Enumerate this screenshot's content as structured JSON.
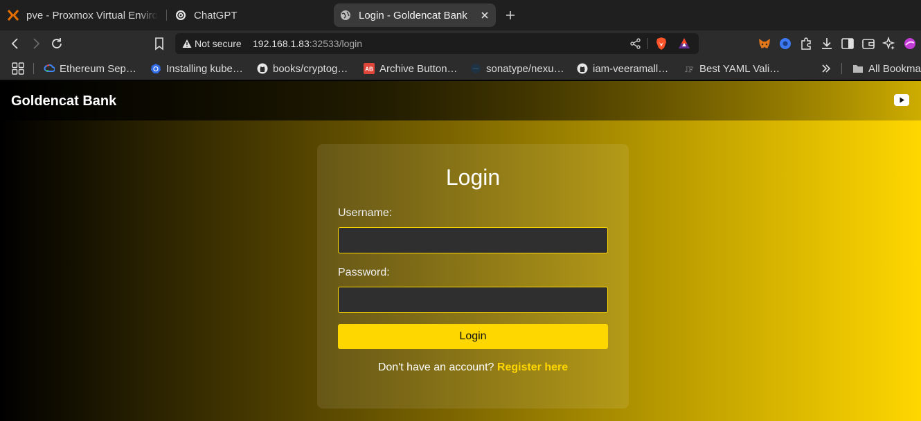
{
  "browser": {
    "tabs": [
      {
        "label": "pve - Proxmox Virtual Environment",
        "icon": "proxmox-icon"
      },
      {
        "label": "ChatGPT",
        "icon": "chatgpt-icon"
      },
      {
        "label": "Login - Goldencat Bank",
        "icon": "globe-icon",
        "active": true
      }
    ],
    "address": {
      "security_label": "Not secure",
      "host": "192.168.1.83",
      "path": ":32533/login"
    },
    "bookmarks": [
      {
        "label": "Ethereum Sep…",
        "icon": "google-cloud-icon"
      },
      {
        "label": "Installing kube…",
        "icon": "kubernetes-icon"
      },
      {
        "label": "books/cryptog…",
        "icon": "github-icon"
      },
      {
        "label": "Archive Button…",
        "icon": "ab-icon"
      },
      {
        "label": "sonatype/nexu…",
        "icon": "sonatype-icon"
      },
      {
        "label": "iam-veeramall…",
        "icon": "github-icon"
      },
      {
        "label": "Best YAML Vali…",
        "icon": "jf-icon"
      },
      {
        "label": "All Bookmarks",
        "icon": "folder-icon"
      }
    ]
  },
  "site": {
    "brand": "Goldencat Bank",
    "login": {
      "title": "Login",
      "username_label": "Username:",
      "username_value": "",
      "password_label": "Password:",
      "password_value": "",
      "submit_label": "Login",
      "register_prompt": "Don't have an account?",
      "register_link": "Register here"
    }
  },
  "colors": {
    "accent": "#ffd700",
    "field_bg": "#2f2f2f",
    "chrome_bg": "#2c2c2c"
  }
}
